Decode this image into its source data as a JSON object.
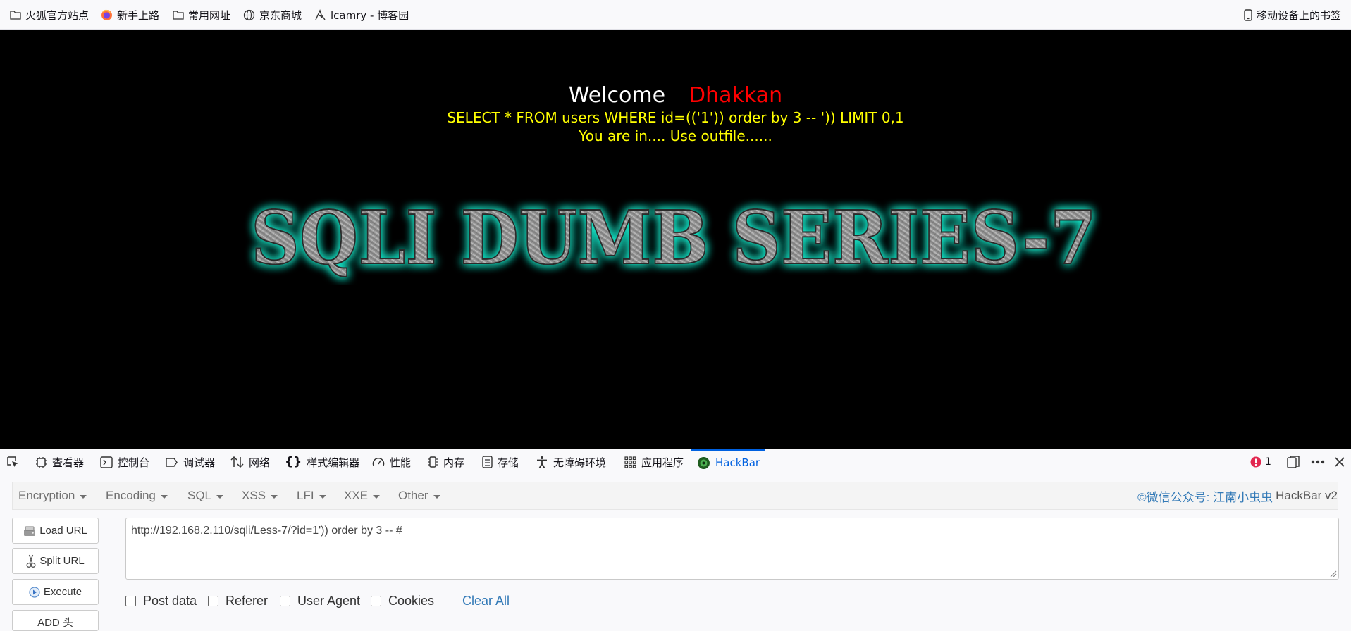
{
  "bookmarks": {
    "items": [
      {
        "label": "火狐官方站点",
        "icon": "folder-icon"
      },
      {
        "label": "新手上路",
        "icon": "firefox-icon"
      },
      {
        "label": "常用网址",
        "icon": "folder-icon"
      },
      {
        "label": "京东商城",
        "icon": "globe-icon"
      },
      {
        "label": "lcamry - 博客园",
        "icon": "site-icon"
      }
    ],
    "mobile": "移动设备上的书签"
  },
  "page": {
    "welcome": "Welcome",
    "username": "Dhakkan",
    "query": "SELECT * FROM users WHERE id=(('1')) order by 3 -- ')) LIMIT 0,1",
    "message": "You are in.... Use outfile......",
    "banner": "SQLI DUMB SERIES-7",
    "colors": {
      "background": "#000000",
      "welcome": "#ffffff",
      "username": "#ff0000",
      "text": "#ffff00",
      "banner_glow": "#19e6c8"
    }
  },
  "devtools": {
    "tabs": [
      {
        "label": "查看器",
        "icon": "inspector-icon"
      },
      {
        "label": "控制台",
        "icon": "console-icon"
      },
      {
        "label": "调试器",
        "icon": "debugger-icon"
      },
      {
        "label": "网络",
        "icon": "network-icon"
      },
      {
        "label": "样式编辑器",
        "icon": "style-editor-icon"
      },
      {
        "label": "性能",
        "icon": "performance-icon"
      },
      {
        "label": "内存",
        "icon": "memory-icon"
      },
      {
        "label": "存储",
        "icon": "storage-icon"
      },
      {
        "label": "无障碍环境",
        "icon": "accessibility-icon"
      },
      {
        "label": "应用程序",
        "icon": "application-icon"
      },
      {
        "label": "HackBar",
        "icon": "hackbar-icon",
        "active": true
      }
    ],
    "error_count": "1",
    "accent": "#0061e0"
  },
  "hackbar": {
    "menu": [
      "Encryption",
      "Encoding",
      "SQL",
      "XSS",
      "LFI",
      "XXE",
      "Other"
    ],
    "credit_prefix": "©微信公众号: 江南小虫虫",
    "credit_name": "HackBar v2",
    "buttons": [
      "Load URL",
      "Split URL",
      "Execute",
      "ADD 头"
    ],
    "url": "http://192.168.2.110/sqli/Less-7/?id=1')) order by 3 -- #",
    "options": [
      "Post data",
      "Referer",
      "User Agent",
      "Cookies"
    ],
    "clear_all": "Clear All"
  }
}
